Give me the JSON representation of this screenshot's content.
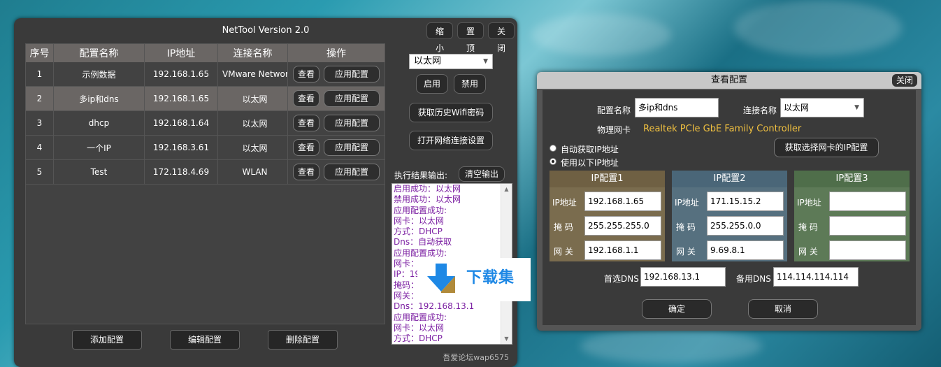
{
  "main": {
    "title": "NetTool Version 2.0",
    "buttons": {
      "minimize": "缩小",
      "pin": "置顶",
      "close": "关闭"
    },
    "table": {
      "headers": [
        "序号",
        "配置名称",
        "IP地址",
        "连接名称",
        "操作"
      ],
      "rows": [
        {
          "no": "1",
          "name": "示例数据",
          "ip": "192.168.1.65",
          "conn": "VMware Network",
          "view": "查看",
          "apply": "应用配置"
        },
        {
          "no": "2",
          "name": "多ip和dns",
          "ip": "192.168.1.65",
          "conn": "以太网",
          "view": "查看",
          "apply": "应用配置"
        },
        {
          "no": "3",
          "name": "dhcp",
          "ip": "192.168.1.64",
          "conn": "以太网",
          "view": "查看",
          "apply": "应用配置"
        },
        {
          "no": "4",
          "name": "一个IP",
          "ip": "192.168.3.61",
          "conn": "以太网",
          "view": "查看",
          "apply": "应用配置"
        },
        {
          "no": "5",
          "name": "Test",
          "ip": "172.118.4.69",
          "conn": "WLAN",
          "view": "查看",
          "apply": "应用配置"
        }
      ]
    },
    "bottom_buttons": {
      "add": "添加配置",
      "edit": "编辑配置",
      "delete": "删除配置"
    },
    "adapter_select": "以太网",
    "enable": "启用",
    "disable": "禁用",
    "wifi_pw": "获取历史Wifi密码",
    "open_net": "打开网络连接设置",
    "output_label": "执行结果输出:",
    "clear_output": "清空输出",
    "output_lines": [
      "启用成功：以太网",
      "禁用成功：以太网",
      "应用配置成功:",
      "网卡：以太网",
      "方式：DHCP",
      "Dns：自动获取",
      "应用配置成功:",
      "网卡：",
      "IP：19",
      "掩码：",
      "网关：",
      "Dns：192.168.13.1",
      "应用配置成功:",
      "网卡：以太网",
      "方式：DHCP"
    ],
    "watermark": "下载集",
    "credit": "吾爱论坛wap6575"
  },
  "dialog": {
    "title": "查看配置",
    "close": "关闭",
    "config_name_label": "配置名称",
    "config_name": "多ip和dns",
    "conn_label": "连接名称",
    "conn_value": "以太网",
    "nic_label": "物理网卡",
    "nic_value": "Realtek PCIe GbE Family Controller",
    "auto_ip": "自动获取IP地址",
    "manual_ip": "使用以下IP地址",
    "get_nic_btn": "获取选择网卡的IP配置",
    "ip_label": "IP地址",
    "mask_label": "掩 码",
    "gw_label": "网 关",
    "groups": [
      {
        "title": "IP配置1",
        "ip": "192.168.1.65",
        "mask": "255.255.255.0",
        "gw": "192.168.1.1"
      },
      {
        "title": "IP配置2",
        "ip": "171.15.15.2",
        "mask": "255.255.0.0",
        "gw": "9.69.8.1"
      },
      {
        "title": "IP配置3",
        "ip": "",
        "mask": "",
        "gw": ""
      }
    ],
    "dns1_label": "首选DNS",
    "dns1": "192.168.13.1",
    "dns2_label": "备用DNS",
    "dns2": "114.114.114.114",
    "ok": "确定",
    "cancel": "取消"
  },
  "colors": {
    "output_text": "#7b1fa2",
    "nic_text": "#f0c040"
  }
}
